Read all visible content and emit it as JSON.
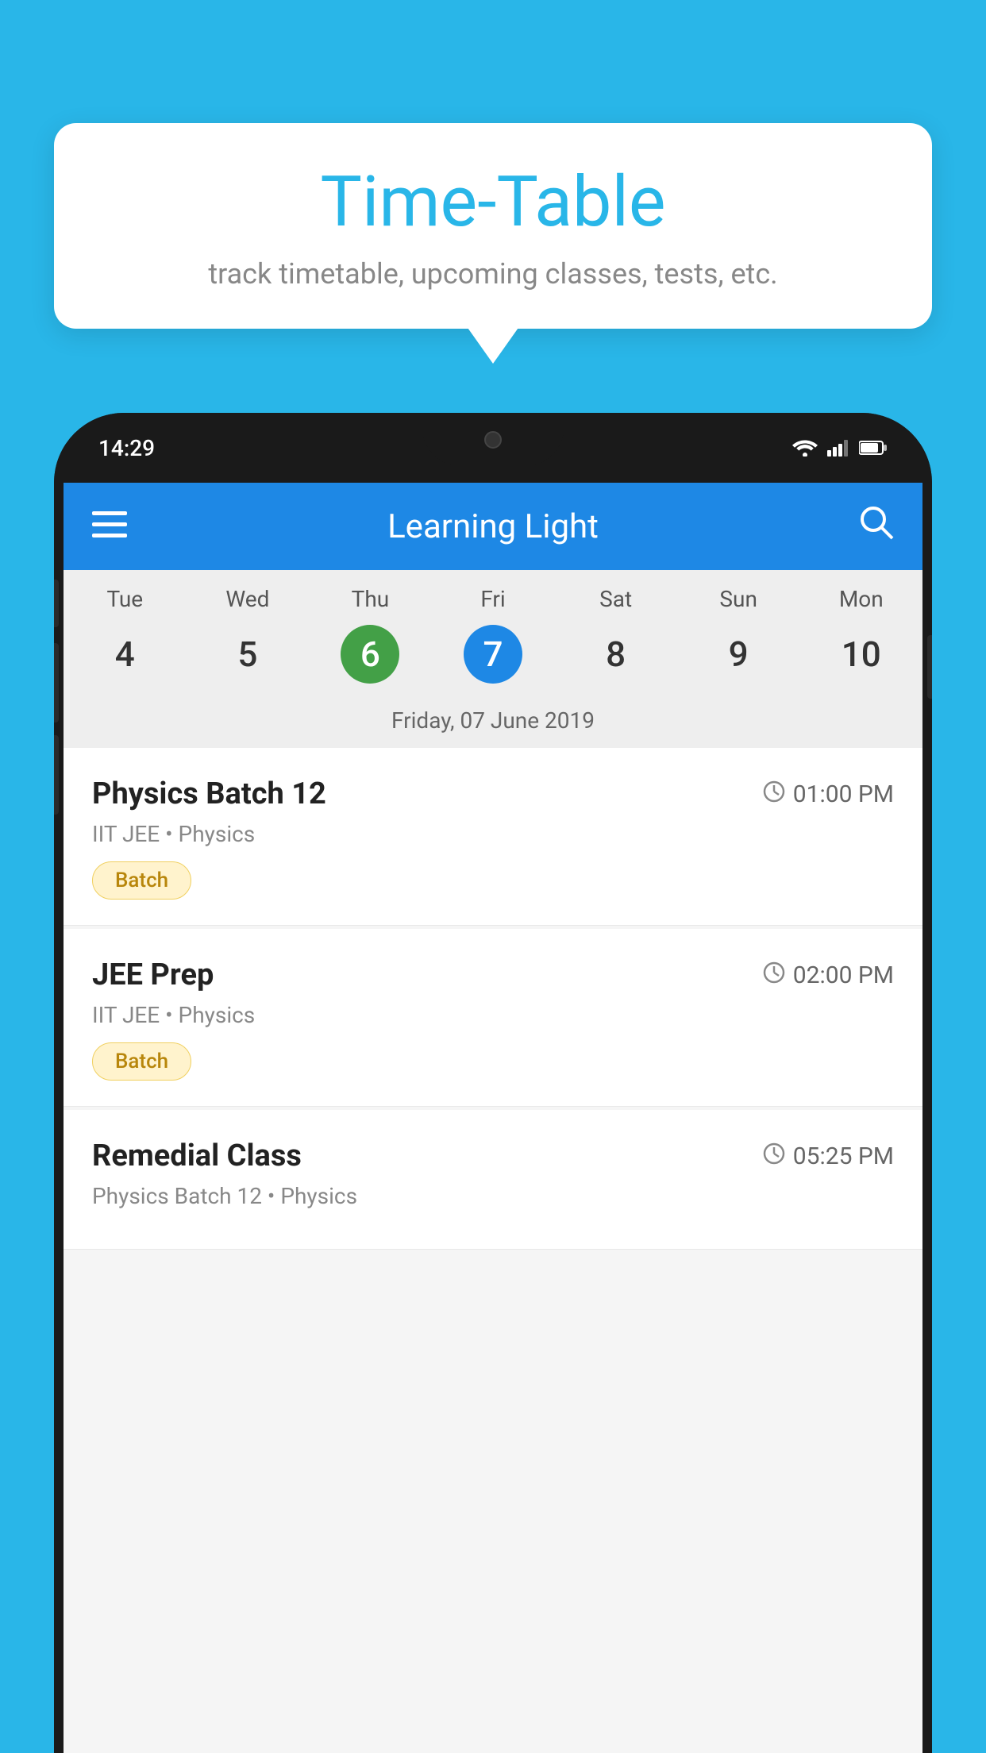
{
  "background_color": "#29b6e8",
  "tooltip": {
    "title": "Time-Table",
    "subtitle": "track timetable, upcoming classes, tests, etc."
  },
  "phone": {
    "status_bar": {
      "time": "14:29"
    },
    "app_bar": {
      "title": "Learning Light"
    },
    "calendar": {
      "days": [
        "Tue",
        "Wed",
        "Thu",
        "Fri",
        "Sat",
        "Sun",
        "Mon"
      ],
      "dates": [
        "4",
        "5",
        "6",
        "7",
        "8",
        "9",
        "10"
      ],
      "today_index": 2,
      "selected_index": 3,
      "selected_date_label": "Friday, 07 June 2019"
    },
    "schedule": [
      {
        "title": "Physics Batch 12",
        "time": "01:00 PM",
        "subtitle": "IIT JEE • Physics",
        "tag": "Batch"
      },
      {
        "title": "JEE Prep",
        "time": "02:00 PM",
        "subtitle": "IIT JEE • Physics",
        "tag": "Batch"
      },
      {
        "title": "Remedial Class",
        "time": "05:25 PM",
        "subtitle": "Physics Batch 12 • Physics",
        "tag": null
      }
    ]
  }
}
